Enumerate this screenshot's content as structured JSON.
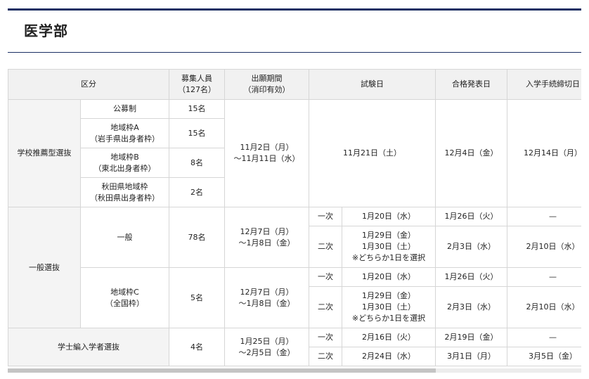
{
  "title": "医学部",
  "headers": {
    "category": "区分",
    "capacity": "募集人員",
    "capacity_total": "（127名）",
    "period": "出願期間",
    "period_note": "（消印有効）",
    "exam_date": "試験日",
    "result_date": "合格発表日",
    "deadline": "入学手続締切日"
  },
  "school": {
    "label": "学校推薦型選抜",
    "rows": [
      {
        "name": "公募制",
        "sub": "",
        "capacity": "15名"
      },
      {
        "name": "地域枠A",
        "sub": "（岩手県出身者枠）",
        "capacity": "15名"
      },
      {
        "name": "地域枠B",
        "sub": "（東北出身者枠）",
        "capacity": "8名"
      },
      {
        "name": "秋田県地域枠",
        "sub": "（秋田県出身者枠）",
        "capacity": "2名"
      }
    ],
    "period_1": "11月2日（月）",
    "period_2": "～11月11日（水）",
    "exam": "11月21日（土）",
    "result": "12月4日（金）",
    "deadline": "12月14日（月）"
  },
  "general": {
    "label": "一般選抜",
    "groups": [
      {
        "name": "一般",
        "sub": "",
        "capacity": "78名",
        "period_1": "12月7日（月）",
        "period_2": "～1月8日（金）",
        "stage1": {
          "label": "一次",
          "exam": "1月20日（水）",
          "result": "1月26日（火）",
          "deadline": "—"
        },
        "stage2": {
          "label": "二次",
          "exam_1": "1月29日（金）",
          "exam_2": "1月30日（土）",
          "exam_note": "※どちらか1日を選択",
          "result": "2月3日（水）",
          "deadline": "2月10日（水）"
        }
      },
      {
        "name": "地域枠C",
        "sub": "（全国枠）",
        "capacity": "5名",
        "period_1": "12月7日（月）",
        "period_2": "～1月8日（金）",
        "stage1": {
          "label": "一次",
          "exam": "1月20日（水）",
          "result": "1月26日（火）",
          "deadline": "—"
        },
        "stage2": {
          "label": "二次",
          "exam_1": "1月29日（金）",
          "exam_2": "1月30日（土）",
          "exam_note": "※どちらか1日を選択",
          "result": "2月3日（水）",
          "deadline": "2月10日（水）"
        }
      }
    ]
  },
  "transfer": {
    "label": "学士編入学者選抜",
    "capacity": "4名",
    "period_1": "1月25日（月）",
    "period_2": "～2月5日（金）",
    "stage1": {
      "label": "一次",
      "exam": "2月16日（火）",
      "result": "2月19日（金）",
      "deadline": "—"
    },
    "stage2": {
      "label": "二次",
      "exam": "2月24日（水）",
      "result": "3月1日（月）",
      "deadline": "3月5日（金）"
    }
  },
  "colors": {
    "accent": "#1b2f63",
    "header_bg": "#f1f1f1",
    "cell_shade": "#f4f4f4",
    "border": "#d6d6d6"
  }
}
